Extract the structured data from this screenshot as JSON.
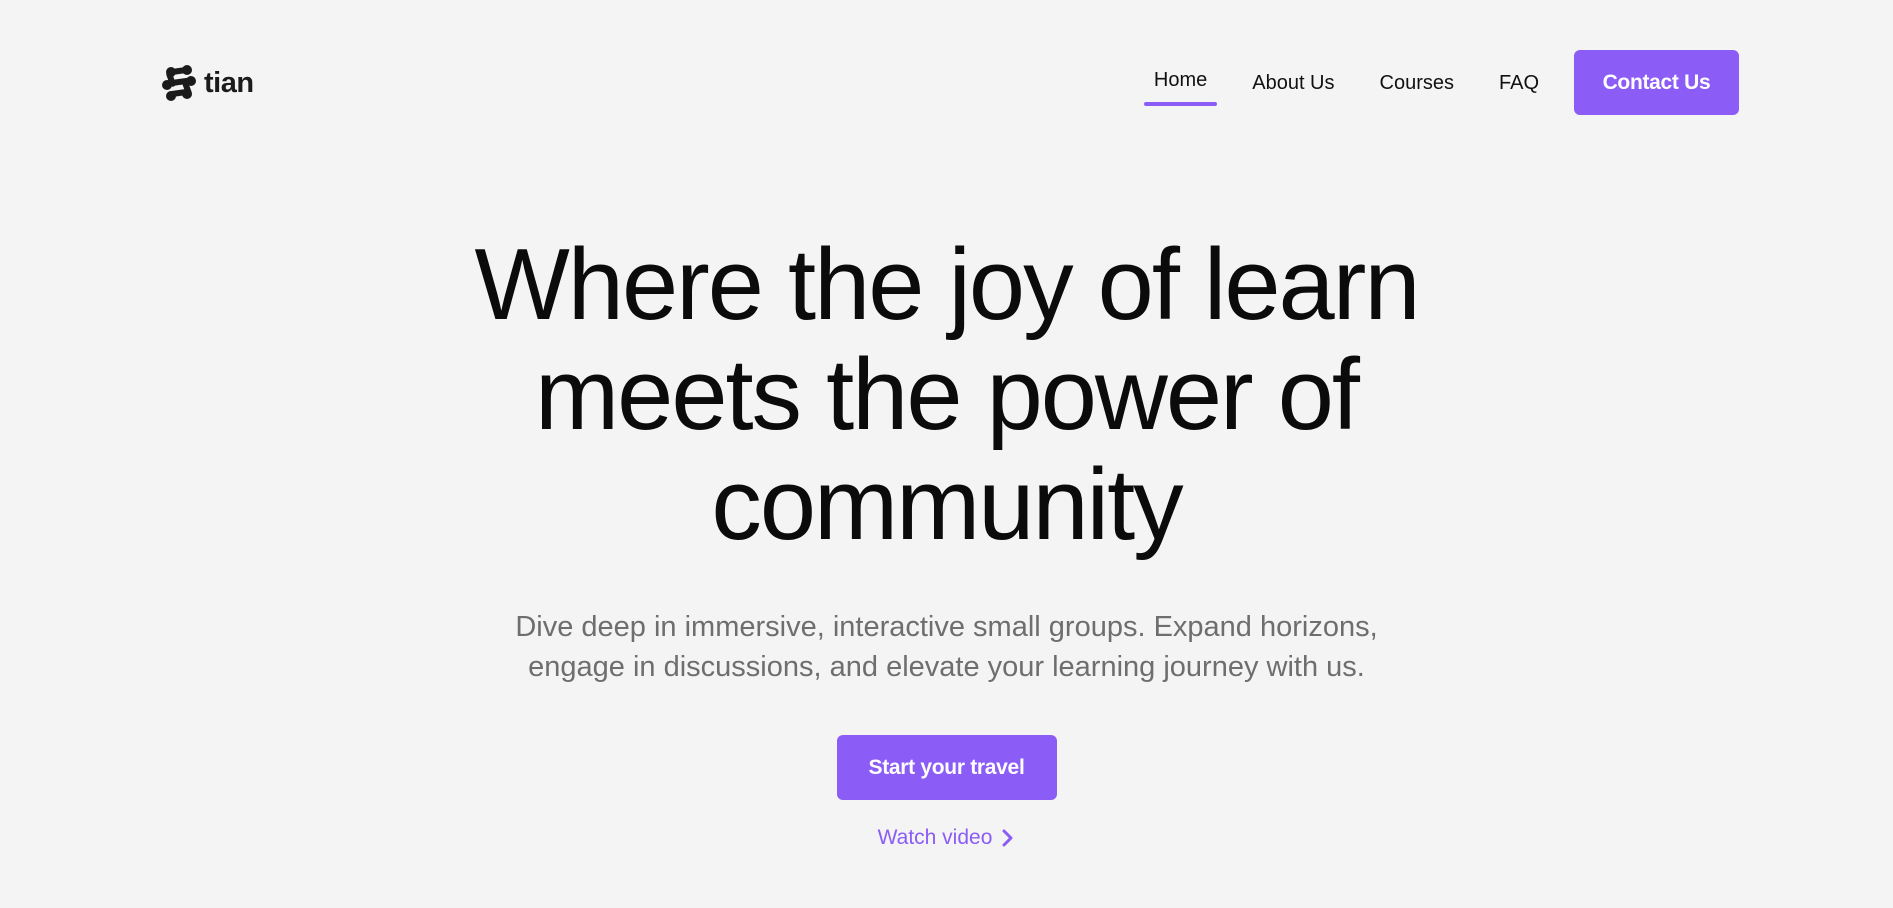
{
  "brand": {
    "name": "tian",
    "logo_icon": "tian-logo-icon",
    "accent_color": "#8b5cf6"
  },
  "nav": {
    "items": [
      {
        "label": "Home",
        "active": true
      },
      {
        "label": "About Us",
        "active": false
      },
      {
        "label": "Courses",
        "active": false
      },
      {
        "label": "FAQ",
        "active": false
      }
    ],
    "contact_label": "Contact Us"
  },
  "hero": {
    "title_line1": "Where the joy of learn",
    "title_line2": "meets the power of",
    "title_line3": "community",
    "subtitle_line1": "Dive deep in immersive, interactive small groups. Expand horizons,",
    "subtitle_line2": "engage in discussions, and elevate your learning journey with us.",
    "cta_label": "Start your travel",
    "watch_label": "Watch video",
    "watch_icon": "chevron-right-icon"
  }
}
